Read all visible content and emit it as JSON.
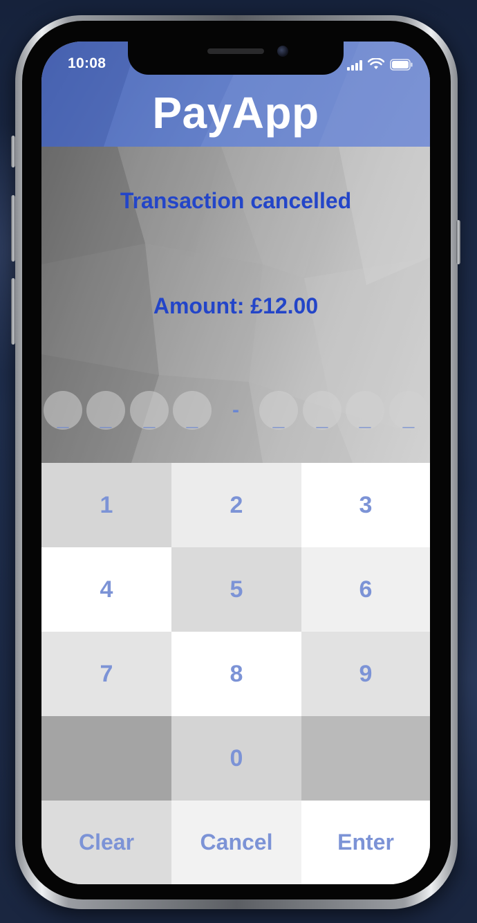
{
  "status_bar": {
    "time": "10:08",
    "icons": [
      "signal-icon",
      "wifi-icon",
      "battery-icon"
    ]
  },
  "header": {
    "title": "PayApp"
  },
  "transaction": {
    "status_message": "Transaction cancelled",
    "amount_text": "Amount: £12.00"
  },
  "pin": {
    "slots": [
      "_",
      "_",
      "_",
      "_",
      "-",
      "_",
      "_",
      "_",
      "_"
    ]
  },
  "keypad": {
    "keys": [
      "1",
      "2",
      "3",
      "4",
      "5",
      "6",
      "7",
      "8",
      "9",
      "",
      "0",
      ""
    ],
    "clear_label": "Clear",
    "cancel_label": "Cancel",
    "enter_label": "Enter"
  },
  "colors": {
    "header_blue": "#6985cc",
    "message_blue": "#2345c8",
    "key_text": "#7c93d6"
  }
}
